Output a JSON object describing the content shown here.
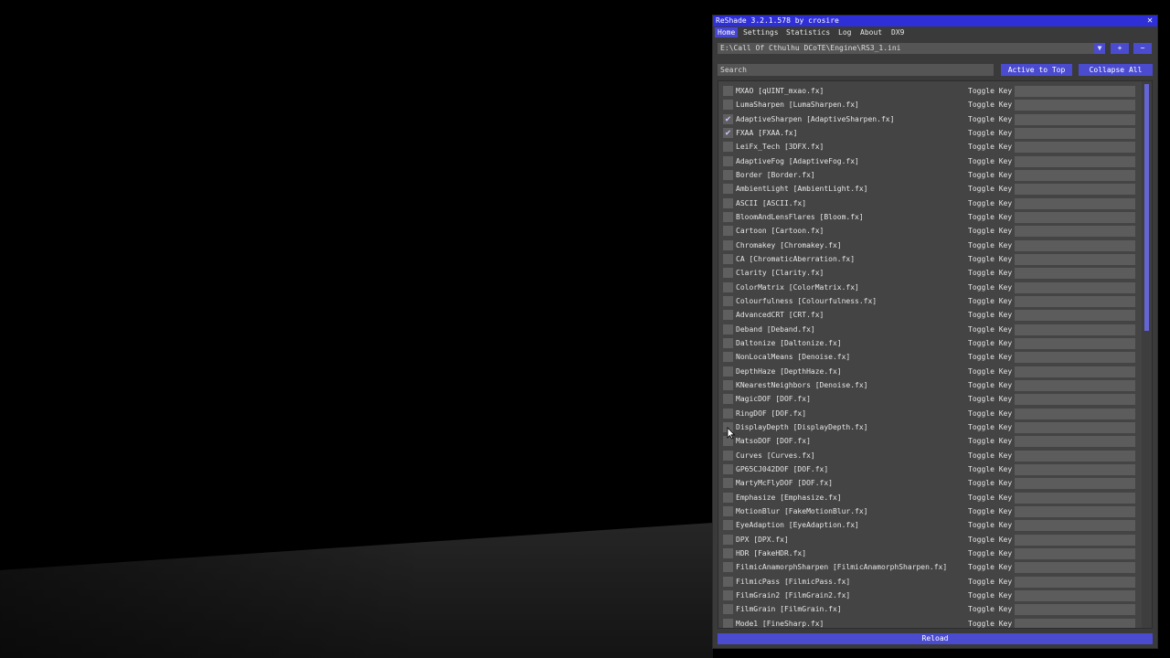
{
  "window": {
    "title": "ReShade 3.2.1.578 by crosire",
    "close_glyph": "✕"
  },
  "tabs": [
    {
      "label": "Home",
      "active": true
    },
    {
      "label": "Settings",
      "active": false
    },
    {
      "label": "Statistics",
      "active": false
    },
    {
      "label": "Log",
      "active": false
    },
    {
      "label": "About",
      "active": false
    },
    {
      "label": "DX9",
      "active": false
    }
  ],
  "preset": {
    "path": "E:\\Call Of Cthulhu DCoTE\\Engine\\RS3_1.ini",
    "dropdown_glyph": "▼",
    "add_label": "+",
    "remove_label": "−"
  },
  "search": {
    "placeholder": "Search",
    "active_to_top_label": "Active to Top",
    "collapse_all_label": "Collapse All"
  },
  "toggle_key_label": "Toggle Key",
  "check_glyph": "✔",
  "effects": [
    {
      "label": "MXAO [qUINT_mxao.fx]",
      "checked": false
    },
    {
      "label": "LumaSharpen [LumaSharpen.fx]",
      "checked": false
    },
    {
      "label": "AdaptiveSharpen [AdaptiveSharpen.fx]",
      "checked": true
    },
    {
      "label": "FXAA [FXAA.fx]",
      "checked": true
    },
    {
      "label": "LeiFx_Tech [3DFX.fx]",
      "checked": false
    },
    {
      "label": "AdaptiveFog [AdaptiveFog.fx]",
      "checked": false
    },
    {
      "label": "Border [Border.fx]",
      "checked": false
    },
    {
      "label": "AmbientLight [AmbientLight.fx]",
      "checked": false
    },
    {
      "label": "ASCII [ASCII.fx]",
      "checked": false
    },
    {
      "label": "BloomAndLensFlares [Bloom.fx]",
      "checked": false
    },
    {
      "label": "Cartoon [Cartoon.fx]",
      "checked": false
    },
    {
      "label": "Chromakey [Chromakey.fx]",
      "checked": false
    },
    {
      "label": "CA [ChromaticAberration.fx]",
      "checked": false
    },
    {
      "label": "Clarity [Clarity.fx]",
      "checked": false
    },
    {
      "label": "ColorMatrix [ColorMatrix.fx]",
      "checked": false
    },
    {
      "label": "Colourfulness [Colourfulness.fx]",
      "checked": false
    },
    {
      "label": "AdvancedCRT [CRT.fx]",
      "checked": false
    },
    {
      "label": "Deband [Deband.fx]",
      "checked": false
    },
    {
      "label": "Daltonize [Daltonize.fx]",
      "checked": false
    },
    {
      "label": "NonLocalMeans [Denoise.fx]",
      "checked": false
    },
    {
      "label": "DepthHaze [DepthHaze.fx]",
      "checked": false
    },
    {
      "label": "KNearestNeighbors [Denoise.fx]",
      "checked": false
    },
    {
      "label": "MagicDOF [DOF.fx]",
      "checked": false
    },
    {
      "label": "RingDOF [DOF.fx]",
      "checked": false
    },
    {
      "label": "DisplayDepth [DisplayDepth.fx]",
      "checked": false
    },
    {
      "label": "MatsoDOF [DOF.fx]",
      "checked": false
    },
    {
      "label": "Curves [Curves.fx]",
      "checked": false
    },
    {
      "label": "GP65CJ042DOF [DOF.fx]",
      "checked": false
    },
    {
      "label": "MartyMcFlyDOF [DOF.fx]",
      "checked": false
    },
    {
      "label": "Emphasize [Emphasize.fx]",
      "checked": false
    },
    {
      "label": "MotionBlur [FakeMotionBlur.fx]",
      "checked": false
    },
    {
      "label": "EyeAdaption [EyeAdaption.fx]",
      "checked": false
    },
    {
      "label": "DPX [DPX.fx]",
      "checked": false
    },
    {
      "label": "HDR [FakeHDR.fx]",
      "checked": false
    },
    {
      "label": "FilmicAnamorphSharpen [FilmicAnamorphSharpen.fx]",
      "checked": false
    },
    {
      "label": "FilmicPass [FilmicPass.fx]",
      "checked": false
    },
    {
      "label": "FilmGrain2 [FilmGrain2.fx]",
      "checked": false
    },
    {
      "label": "FilmGrain [FilmGrain.fx]",
      "checked": false
    },
    {
      "label": "Mode1 [FineSharp.fx]",
      "checked": false
    }
  ],
  "reload_label": "Reload",
  "colors": {
    "accent": "#4b4bd0",
    "titlebar": "#2f2fd7",
    "window_bg": "#3a3a3a"
  }
}
